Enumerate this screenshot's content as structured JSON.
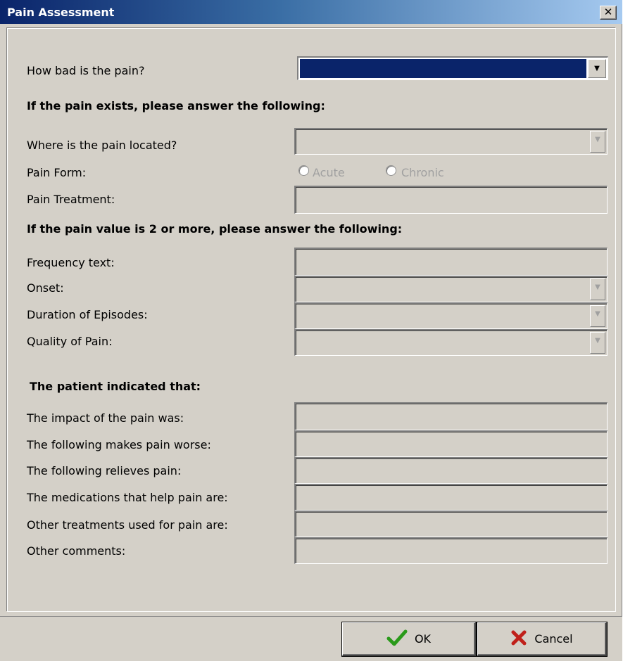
{
  "window": {
    "title": "Pain Assessment",
    "close_label": "✕"
  },
  "section1": {
    "pain_label": "How bad is the pain?",
    "pain_value": ""
  },
  "section2": {
    "heading": "If the pain exists, please answer the following:",
    "location_label": "Where is the pain located?",
    "form_label": "Pain Form:",
    "form_options": [
      "Acute",
      "Chronic"
    ],
    "treatment_label": "Pain Treatment:"
  },
  "section3": {
    "heading": "If the pain value is 2 or more, please answer the following:",
    "frequency_label": "Frequency text:",
    "onset_label": "Onset:",
    "duration_label": "Duration of Episodes:",
    "quality_label": "Quality of Pain:"
  },
  "section4": {
    "heading": "The patient indicated that:",
    "impact_label": "The impact of the pain was:",
    "worse_label": "The following makes pain worse:",
    "relieves_label": "The following relieves pain:",
    "medications_label": "The medications that help pain are:",
    "other_treatments_label": "Other treatments used for pain are:",
    "comments_label": "Other comments:"
  },
  "footer": {
    "ok_label": "OK",
    "cancel_label": "Cancel"
  },
  "colors": {
    "title_gradient_start": "#0a246a",
    "selection": "#0a246a",
    "ok_check": "#2a9a1a",
    "cancel_x": "#c0201a",
    "dialog_bg": "#d4d0c8"
  }
}
